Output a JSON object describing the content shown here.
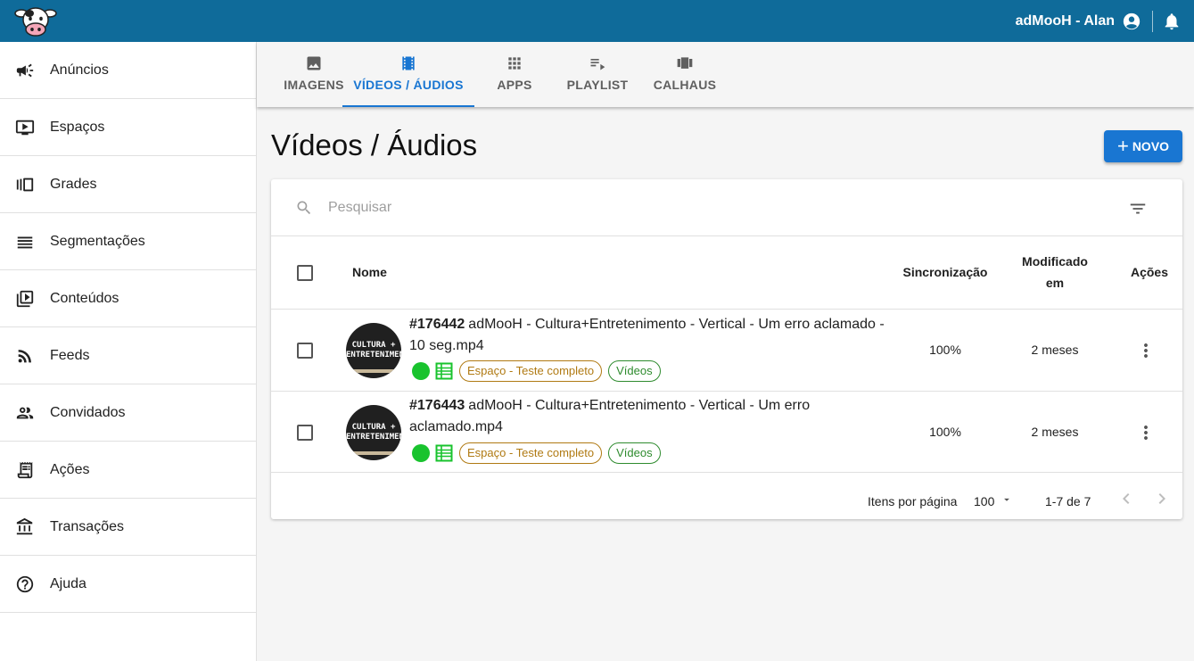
{
  "header": {
    "user_name": "adMooH - Alan",
    "colors": {
      "bar": "#0f6b9a",
      "accent": "#1976d2"
    }
  },
  "sidebar": {
    "items": [
      {
        "label": "Anúncios",
        "icon": "megaphone-icon"
      },
      {
        "label": "Espaços",
        "icon": "screen-play-icon"
      },
      {
        "label": "Grades",
        "icon": "carousel-icon"
      },
      {
        "label": "Segmentações",
        "icon": "lines-icon"
      },
      {
        "label": "Conteúdos",
        "icon": "video-library-icon"
      },
      {
        "label": "Feeds",
        "icon": "rss-icon"
      },
      {
        "label": "Convidados",
        "icon": "people-icon"
      },
      {
        "label": "Ações",
        "icon": "receipt-icon"
      },
      {
        "label": "Transações",
        "icon": "bank-icon"
      },
      {
        "label": "Ajuda",
        "icon": "help-icon"
      }
    ]
  },
  "tabs": [
    {
      "label": "IMAGENS",
      "icon": "image-icon",
      "active": false
    },
    {
      "label": "VÍDEOS / ÁUDIOS",
      "icon": "film-icon",
      "active": true
    },
    {
      "label": "APPS",
      "icon": "apps-grid-icon",
      "active": false
    },
    {
      "label": "PLAYLIST",
      "icon": "playlist-icon",
      "active": false
    },
    {
      "label": "CALHAUS",
      "icon": "view-carousel-icon",
      "active": false
    }
  ],
  "page": {
    "title": "Vídeos / Áudios",
    "new_button": "NOVO"
  },
  "search": {
    "placeholder": "Pesquisar"
  },
  "table": {
    "columns": {
      "name": "Nome",
      "sync": "Sincronização",
      "modified_line1": "Modificado",
      "modified_line2": "em",
      "actions": "Ações"
    },
    "rows": [
      {
        "id": "#176442",
        "name": "adMooH - Cultura+Entretenimento - Vertical - Um erro aclamado - 10 seg.mp4",
        "thumb_line1": "CULTURA +",
        "thumb_line2": "ENTRETENIMENTO",
        "tag_space": "Espaço - Teste completo",
        "tag_type": "Vídeos",
        "sync": "100%",
        "modified": "2 meses"
      },
      {
        "id": "#176443",
        "name": "adMooH - Cultura+Entretenimento - Vertical - Um erro aclamado.mp4",
        "thumb_line1": "CULTURA +",
        "thumb_line2": "ENTRETENIMENTO",
        "tag_space": "Espaço - Teste completo",
        "tag_type": "Vídeos",
        "sync": "100%",
        "modified": "2 meses"
      }
    ]
  },
  "pagination": {
    "items_per_page_label": "Itens por página",
    "items_per_page": "100",
    "range": "1-7 de 7"
  }
}
